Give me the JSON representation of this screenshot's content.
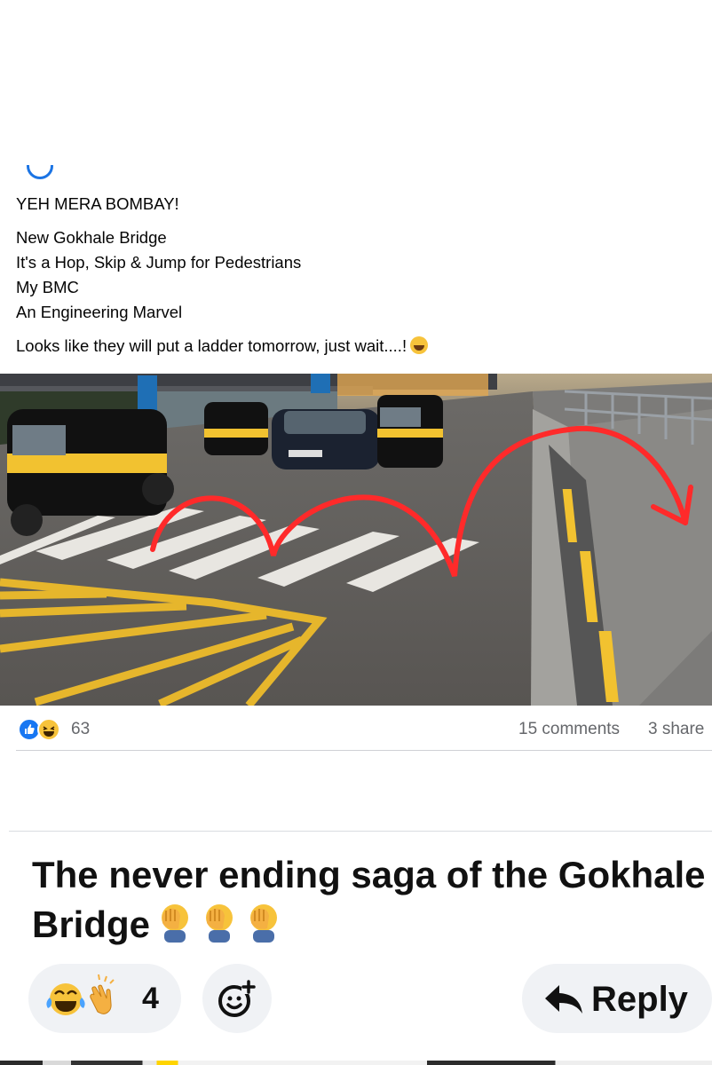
{
  "post": {
    "line1": "YEH MERA BOMBAY!",
    "line2": "New Gokhale Bridge",
    "line3": "It's a Hop, Skip & Jump for Pedestrians",
    "line4": "My BMC",
    "line5": "An Engineering Marvel",
    "line6": "Looks like they will put a ladder tomorrow, just wait....!",
    "line6_emoji": "laughing-emoji"
  },
  "photo": {
    "road_signs_color": "#1f6fb5",
    "marker_color": "#ff2a2a",
    "stripe_color": "#f2c230"
  },
  "reactions": {
    "icons": [
      "like-icon",
      "haha-icon"
    ],
    "count": "63",
    "comments": "15 comments",
    "shares": "3 share"
  },
  "comment": {
    "text": "The never ending saga of the Gokhale Bridge",
    "emojis": [
      "facepalm-icon",
      "facepalm-icon",
      "facepalm-icon"
    ],
    "reaction_icons": [
      "tears-of-joy-icon",
      "clapping-icon"
    ],
    "reaction_count": "4",
    "add_reaction_icon": "add-reaction-icon",
    "reply_icon": "reply-arrow-icon",
    "reply_label": "Reply"
  }
}
